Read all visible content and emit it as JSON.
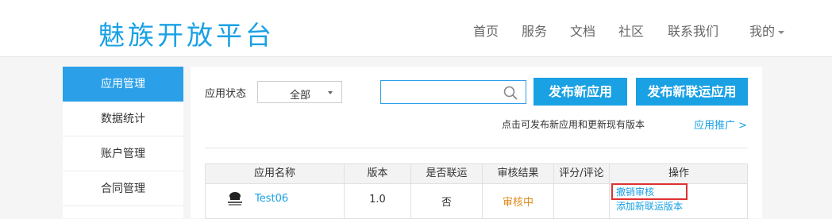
{
  "header": {
    "logo": "魅族开放平台",
    "nav": [
      "首页",
      "服务",
      "文档",
      "社区",
      "联系我们"
    ],
    "user_menu": "我的"
  },
  "sidebar": {
    "items": [
      {
        "label": "应用管理",
        "active": true
      },
      {
        "label": "数据统计"
      },
      {
        "label": "账户管理"
      },
      {
        "label": "合同管理"
      }
    ]
  },
  "filter": {
    "status_label": "应用状态",
    "status_value": "全部",
    "search_value": ""
  },
  "actions": {
    "publish_app": "发布新应用",
    "publish_joint_app": "发布新联运应用",
    "hint": "点击可发布新应用和更新现有版本",
    "promo_link": "应用推广 >"
  },
  "table": {
    "headers": [
      "应用名称",
      "版本",
      "是否联运",
      "审核结果",
      "评分/评论",
      "操作"
    ],
    "rows": [
      {
        "name": "Test06",
        "version": "1.0",
        "joint": "否",
        "review": "审核中",
        "rating": "",
        "ops": [
          "撤销审核",
          "添加新联运版本"
        ]
      }
    ]
  },
  "colors": {
    "brand": "#1aa1e4",
    "pending": "#e08b1c",
    "highlight": "#e03131"
  }
}
